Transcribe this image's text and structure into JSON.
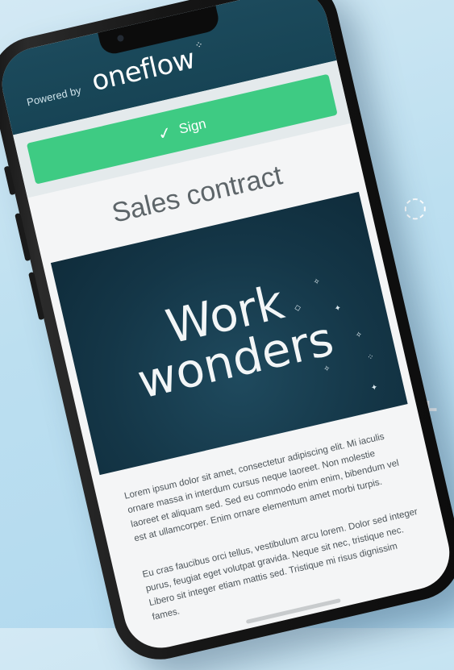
{
  "brand": {
    "powered_by": "Powered by",
    "logo": "oneflow"
  },
  "sign_button": {
    "label": "Sign",
    "icon": "check-icon"
  },
  "document": {
    "title": "Sales contract",
    "hero_line1": "Work",
    "hero_line2": "wonders",
    "paragraphs": [
      "Lorem ipsum dolor sit amet, consectetur adipiscing elit. Mi iaculis ornare massa in interdum cursus neque laoreet. Non molestie laoreet et aliquam sed. Sed eu commodo enim enim, bibendum vel est at ullamcorper. Enim ornare elementum amet morbi turpis.",
      "Eu cras faucibus orci tellus, vestibulum arcu lorem. Dolor sed integer purus, feugiat eget volutpat gravida. Neque sit nec, tristique nec. Libero sit integer etiam mattis sed. Tristique mi risus dignissim fames."
    ]
  },
  "colors": {
    "header": "#174455",
    "sign_green": "#3ecb83",
    "hero_bg": "#143647",
    "background": "#bcdff0"
  }
}
